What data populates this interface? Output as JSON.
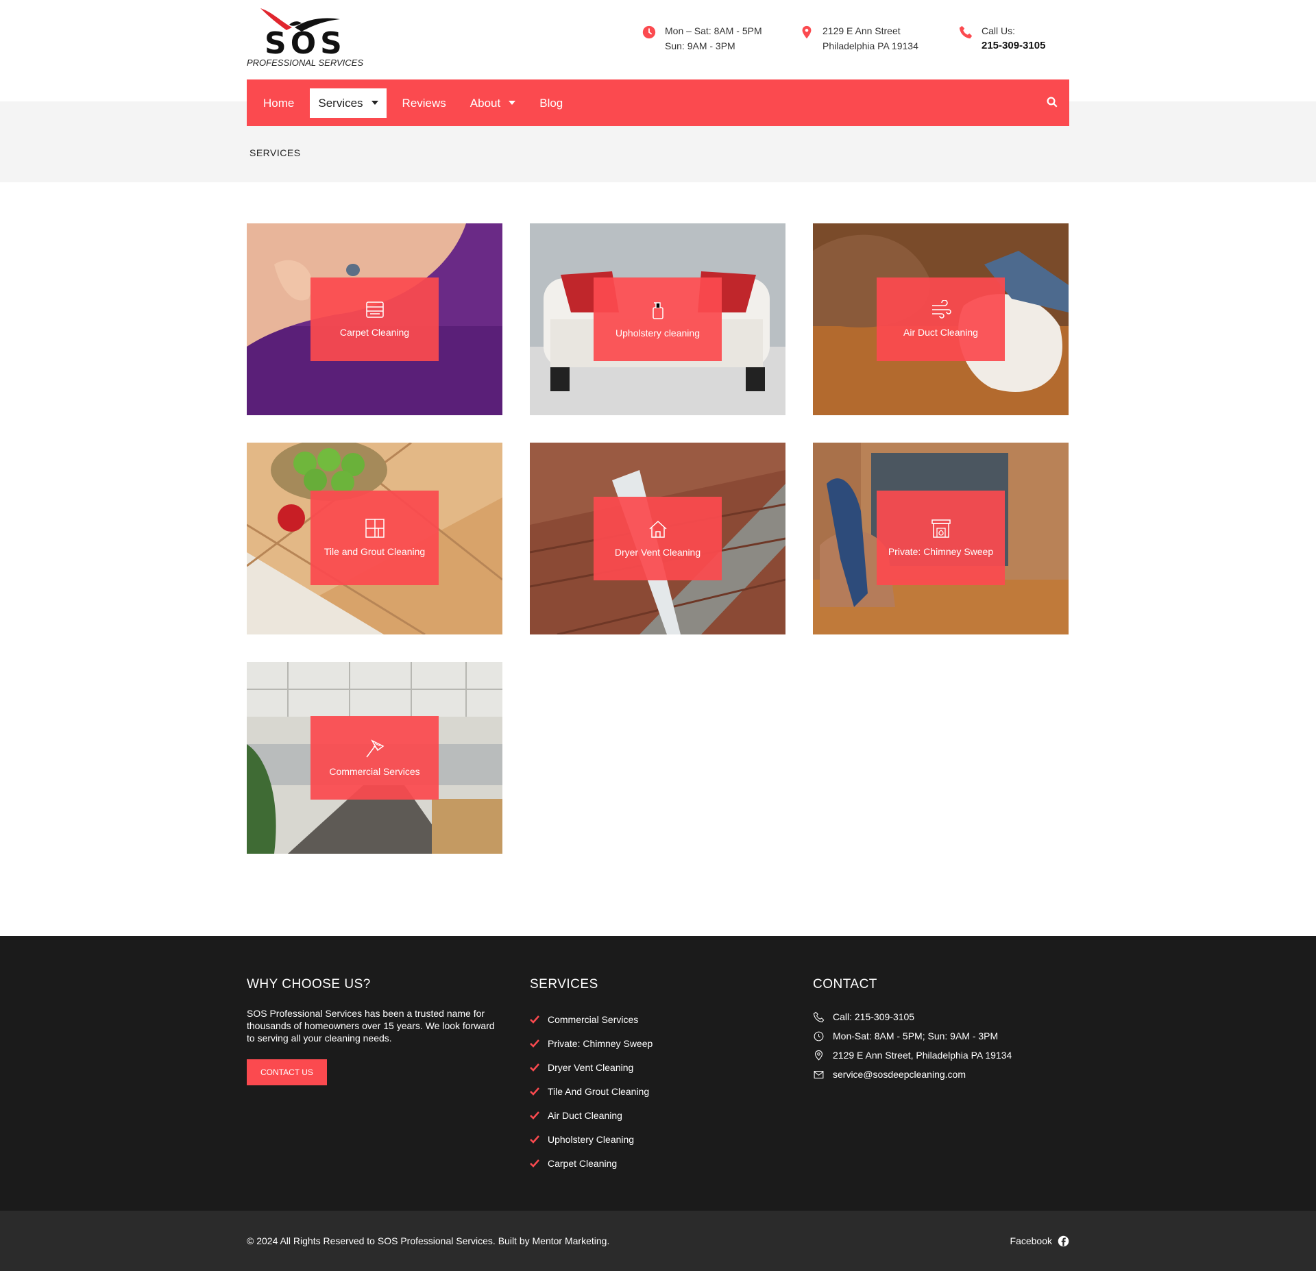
{
  "logo": {
    "name": "SOS",
    "tagline": "PROFESSIONAL SERVICES"
  },
  "header": {
    "hours_line1": "Mon – Sat: 8AM - 5PM",
    "hours_line2": "Sun: 9AM - 3PM",
    "addr_line1": "2129 E Ann Street",
    "addr_line2": "Philadelphia PA 19134",
    "call_label": "Call Us:",
    "call_number": "215-309-3105"
  },
  "nav": {
    "items": [
      {
        "label": "Home"
      },
      {
        "label": "Services"
      },
      {
        "label": "Reviews"
      },
      {
        "label": "About"
      },
      {
        "label": "Blog"
      }
    ],
    "active": "Services"
  },
  "breadcrumb": "SERVICES",
  "services": [
    {
      "label": "Carpet Cleaning",
      "icon": "carpet-icon"
    },
    {
      "label": "Upholstery cleaning",
      "icon": "spray-bottle-icon"
    },
    {
      "label": "Air Duct Cleaning",
      "icon": "wind-icon"
    },
    {
      "label": "Tile and Grout Cleaning",
      "icon": "tile-icon"
    },
    {
      "label": "Dryer Vent Cleaning",
      "icon": "house-icon"
    },
    {
      "label": "Private: Chimney Sweep",
      "icon": "fireplace-icon"
    },
    {
      "label": "Commercial Services",
      "icon": "duster-icon"
    }
  ],
  "footer": {
    "why_title": "WHY CHOOSE US?",
    "why_text": "SOS Professional Services has been a trusted name for thousands of homeowners over 15 years. We look forward to serving all your cleaning needs.",
    "contact_button": "CONTACT US",
    "services_title": "SERVICES",
    "services_list": [
      "Commercial Services",
      "Private: Chimney Sweep",
      "Dryer Vent Cleaning",
      "Tile And Grout Cleaning",
      "Air Duct Cleaning",
      "Upholstery Cleaning",
      "Carpet Cleaning"
    ],
    "contact_title": "CONTACT",
    "contact_call": "Call: 215-309-3105",
    "contact_hours": "Mon-Sat: 8AM - 5PM; Sun: 9AM - 3PM",
    "contact_address": "2129 E Ann Street, Philadelphia PA 19134",
    "contact_email": "service@sosdeepcleaning.com"
  },
  "bottom": {
    "copyright": "© 2024 All Rights Reserved to SOS Professional Services. Built by Mentor Marketing.",
    "facebook": "Facebook"
  },
  "colors": {
    "accent": "#fb4a4f",
    "footer_bg": "#1b1b1b",
    "bottom_bg": "#2b2b2b"
  }
}
